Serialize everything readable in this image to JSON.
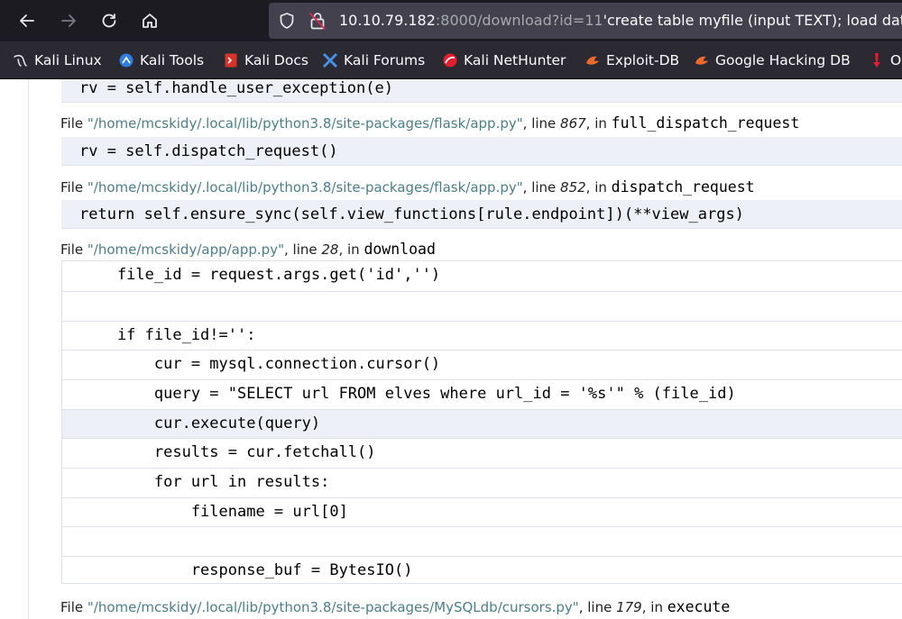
{
  "browser": {
    "url_host": "10.10.79.182",
    "url_rest": ":8000/download?id=11",
    "url_query": "'create table myfile (input TEXT); load dat"
  },
  "bookmarks": [
    {
      "label": "Kali Linux",
      "icon": "kali-dragon-icon"
    },
    {
      "label": "Kali Tools",
      "icon": "kali-tools-icon"
    },
    {
      "label": "Kali Docs",
      "icon": "kali-docs-icon"
    },
    {
      "label": "Kali Forums",
      "icon": "kali-forums-icon"
    },
    {
      "label": "Kali NetHunter",
      "icon": "kali-nethunter-icon"
    },
    {
      "label": "Exploit-DB",
      "icon": "exploit-db-icon"
    },
    {
      "label": "Google Hacking DB",
      "icon": "ghdb-icon"
    },
    {
      "label": "O",
      "icon": "offsec-icon"
    }
  ],
  "traceback": {
    "top_code": "rv = self.handle_user_exception(e)",
    "frame1": {
      "prefix": "File ",
      "path": "\"/home/mcskidy/.local/lib/python3.8/site-packages/flask/app.py\"",
      "line_label": ", line ",
      "line": "867",
      "in_label": ", in ",
      "func": "full_dispatch_request",
      "code": "rv = self.dispatch_request()"
    },
    "frame2": {
      "prefix": "File ",
      "path": "\"/home/mcskidy/.local/lib/python3.8/site-packages/flask/app.py\"",
      "line_label": ", line ",
      "line": "852",
      "in_label": ", in ",
      "func": "dispatch_request",
      "code": "return self.ensure_sync(self.view_functions[rule.endpoint])(**view_args)"
    },
    "frame3": {
      "prefix": "File ",
      "path": "\"/home/mcskidy/app/app.py\"",
      "line_label": ", line ",
      "line": "28",
      "in_label": ", in ",
      "func": "download",
      "source": [
        "    file_id = request.args.get('id','')",
        "",
        "    if file_id!='':",
        "        cur = mysql.connection.cursor()",
        "        query = \"SELECT url FROM elves where url_id = '%s'\" % (file_id)",
        "        cur.execute(query)",
        "        results = cur.fetchall()",
        "        for url in results:",
        "            filename = url[0]",
        "",
        "            response_buf = BytesIO()"
      ]
    },
    "frame4": {
      "prefix": "File ",
      "path": "\"/home/mcskidy/.local/lib/python3.8/site-packages/MySQLdb/cursors.py\"",
      "line_label": ", line ",
      "line": "179",
      "in_label": ", in ",
      "func": "execute"
    }
  }
}
